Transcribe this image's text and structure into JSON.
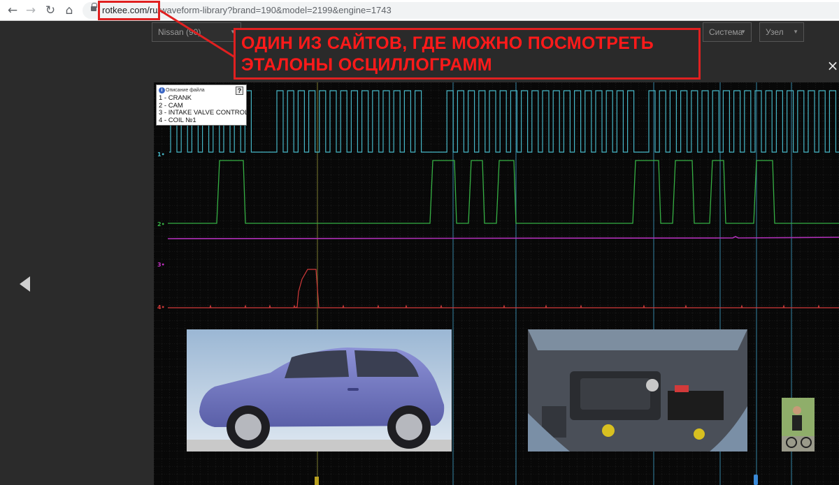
{
  "browser": {
    "url_host": "rotkee.com/ru/",
    "url_path": "waveform-library?brand=190&model=2199&engine=1743",
    "back_icon": "arrow-left-icon",
    "forward_icon": "arrow-right-icon",
    "reload_icon": "reload-icon",
    "home_icon": "home-icon",
    "lock_icon": "lock-icon"
  },
  "filters": [
    {
      "value": "Nissan (90)"
    },
    {
      "value": ""
    },
    {
      "value": ""
    },
    {
      "value": ""
    },
    {
      "value": "Система"
    },
    {
      "value": "Узел"
    }
  ],
  "annotation": {
    "line1": "ОДИН ИЗ САЙТОВ, ГДЕ МОЖНО ПОСМОТРЕТЬ",
    "line2": "ЭТАЛОНЫ ОСЦИЛЛОГРАММ",
    "color": "#e02020"
  },
  "modal": {
    "close_label": "×",
    "prev_icon": "triangle-left-icon"
  },
  "legend": {
    "title": "Описание файла",
    "info_glyph": "i",
    "help_label": "?",
    "items": [
      "1 - CRANK",
      "2 - CAM",
      "3 - INTAKE VALVE CONTROL",
      "4 - COIL №1"
    ]
  },
  "channels": [
    {
      "id": "1",
      "marker": "1•",
      "name": "CRANK",
      "color": "#46b6c6"
    },
    {
      "id": "2",
      "marker": "2•",
      "name": "CAM",
      "color": "#36b044"
    },
    {
      "id": "3",
      "marker": "3•",
      "name": "INTAKE VALVE CONTROL",
      "color": "#c030c0"
    },
    {
      "id": "4",
      "marker": "4•",
      "name": "COIL №1",
      "color": "#d23a3a"
    }
  ],
  "photos": {
    "car_name": "car-photo",
    "engine_name": "engine-bay-photo",
    "thumb_name": "person-thumbnail"
  }
}
